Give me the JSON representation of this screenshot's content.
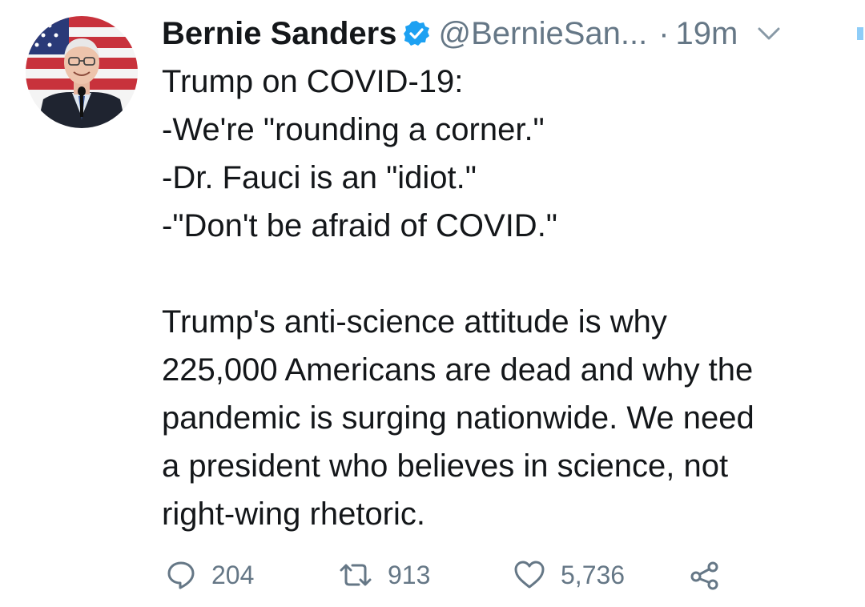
{
  "author": {
    "name": "Bernie Sanders",
    "handle": "@BernieSan...",
    "separator": "·",
    "time": "19m",
    "verified": true
  },
  "tweet": {
    "lines": [
      "Trump on COVID-19:",
      "-We're \"rounding a corner.\"",
      "-Dr. Fauci is an \"idiot.\"",
      "-\"Don't be afraid of COVID.\"",
      "",
      "Trump's anti-science attitude is why",
      "225,000 Americans are dead and why the",
      "pandemic is surging nationwide. We need",
      "a president who believes in science, not",
      "right-wing rhetoric."
    ]
  },
  "actions": {
    "replies": "204",
    "retweets": "913",
    "likes": "5,736"
  },
  "colors": {
    "verified_blue": "#1da1f2",
    "muted_gray": "#657786",
    "text": "#14171a"
  },
  "icons": [
    "verified-badge-icon",
    "chevron-down-icon",
    "reply-icon",
    "retweet-icon",
    "like-icon",
    "share-icon"
  ]
}
